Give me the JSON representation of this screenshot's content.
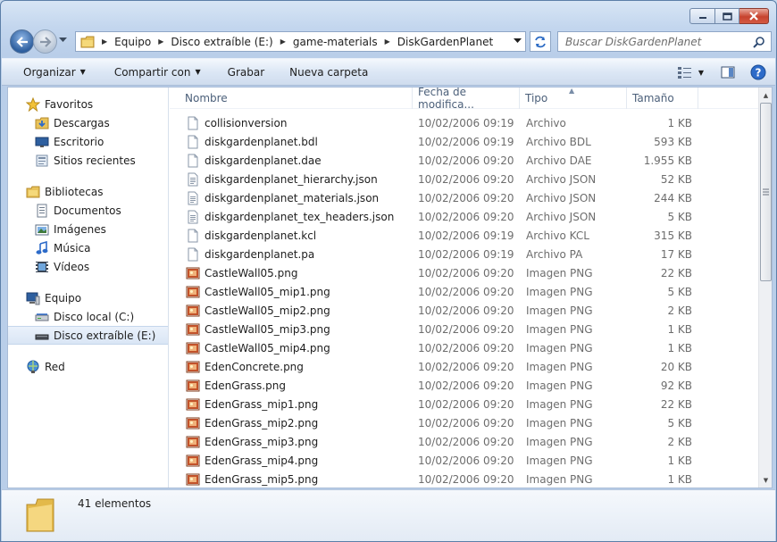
{
  "window": {
    "caption_buttons": [
      "minimize",
      "maximize",
      "close"
    ],
    "accent_close": "#c7432e"
  },
  "address": {
    "crumbs": [
      "Equipo",
      "Disco extraíble (E:)",
      "game-materials",
      "DiskGardenPlanet"
    ]
  },
  "search": {
    "placeholder": "Buscar DiskGardenPlanet"
  },
  "toolbar": {
    "organize": "Organizar",
    "share": "Compartir con",
    "burn": "Grabar",
    "new_folder": "Nueva carpeta"
  },
  "sidebar": {
    "favorites": {
      "label": "Favoritos",
      "items": [
        "Descargas",
        "Escritorio",
        "Sitios recientes"
      ]
    },
    "libraries": {
      "label": "Bibliotecas",
      "items": [
        "Documentos",
        "Imágenes",
        "Música",
        "Vídeos"
      ]
    },
    "computer": {
      "label": "Equipo",
      "items": [
        "Disco local (C:)",
        "Disco extraíble (E:)"
      ],
      "selected": "Disco extraíble (E:)"
    },
    "network": {
      "label": "Red"
    }
  },
  "columns": {
    "name": "Nombre",
    "date": "Fecha de modifica...",
    "type": "Tipo",
    "size": "Tamaño"
  },
  "files": [
    {
      "name": "collisionversion",
      "date": "10/02/2006 09:19 a...",
      "type": "Archivo",
      "size": "1 KB",
      "icon": "generic-file-icon"
    },
    {
      "name": "diskgardenplanet.bdl",
      "date": "10/02/2006 09:19 a...",
      "type": "Archivo BDL",
      "size": "593 KB",
      "icon": "generic-file-icon"
    },
    {
      "name": "diskgardenplanet.dae",
      "date": "10/02/2006 09:20 a...",
      "type": "Archivo DAE",
      "size": "1.955 KB",
      "icon": "generic-file-icon"
    },
    {
      "name": "diskgardenplanet_hierarchy.json",
      "date": "10/02/2006 09:20 a...",
      "type": "Archivo JSON",
      "size": "52 KB",
      "icon": "text-file-icon"
    },
    {
      "name": "diskgardenplanet_materials.json",
      "date": "10/02/2006 09:20 a...",
      "type": "Archivo JSON",
      "size": "244 KB",
      "icon": "text-file-icon"
    },
    {
      "name": "diskgardenplanet_tex_headers.json",
      "date": "10/02/2006 09:20 a...",
      "type": "Archivo JSON",
      "size": "5 KB",
      "icon": "text-file-icon"
    },
    {
      "name": "diskgardenplanet.kcl",
      "date": "10/02/2006 09:19 a...",
      "type": "Archivo KCL",
      "size": "315 KB",
      "icon": "generic-file-icon"
    },
    {
      "name": "diskgardenplanet.pa",
      "date": "10/02/2006 09:19 a...",
      "type": "Archivo PA",
      "size": "17 KB",
      "icon": "generic-file-icon"
    },
    {
      "name": "CastleWall05.png",
      "date": "10/02/2006 09:20 a...",
      "type": "Imagen PNG",
      "size": "22 KB",
      "icon": "image-file-icon"
    },
    {
      "name": "CastleWall05_mip1.png",
      "date": "10/02/2006 09:20 a...",
      "type": "Imagen PNG",
      "size": "5 KB",
      "icon": "image-file-icon"
    },
    {
      "name": "CastleWall05_mip2.png",
      "date": "10/02/2006 09:20 a...",
      "type": "Imagen PNG",
      "size": "2 KB",
      "icon": "image-file-icon"
    },
    {
      "name": "CastleWall05_mip3.png",
      "date": "10/02/2006 09:20 a...",
      "type": "Imagen PNG",
      "size": "1 KB",
      "icon": "image-file-icon"
    },
    {
      "name": "CastleWall05_mip4.png",
      "date": "10/02/2006 09:20 a...",
      "type": "Imagen PNG",
      "size": "1 KB",
      "icon": "image-file-icon"
    },
    {
      "name": "EdenConcrete.png",
      "date": "10/02/2006 09:20 a...",
      "type": "Imagen PNG",
      "size": "20 KB",
      "icon": "image-file-icon"
    },
    {
      "name": "EdenGrass.png",
      "date": "10/02/2006 09:20 a...",
      "type": "Imagen PNG",
      "size": "92 KB",
      "icon": "image-file-icon"
    },
    {
      "name": "EdenGrass_mip1.png",
      "date": "10/02/2006 09:20 a...",
      "type": "Imagen PNG",
      "size": "22 KB",
      "icon": "image-file-icon"
    },
    {
      "name": "EdenGrass_mip2.png",
      "date": "10/02/2006 09:20 a...",
      "type": "Imagen PNG",
      "size": "5 KB",
      "icon": "image-file-icon"
    },
    {
      "name": "EdenGrass_mip3.png",
      "date": "10/02/2006 09:20 a...",
      "type": "Imagen PNG",
      "size": "2 KB",
      "icon": "image-file-icon"
    },
    {
      "name": "EdenGrass_mip4.png",
      "date": "10/02/2006 09:20 a...",
      "type": "Imagen PNG",
      "size": "1 KB",
      "icon": "image-file-icon"
    },
    {
      "name": "EdenGrass_mip5.png",
      "date": "10/02/2006 09:20 a...",
      "type": "Imagen PNG",
      "size": "1 KB",
      "icon": "image-file-icon"
    }
  ],
  "details": {
    "count": "41 elementos"
  }
}
